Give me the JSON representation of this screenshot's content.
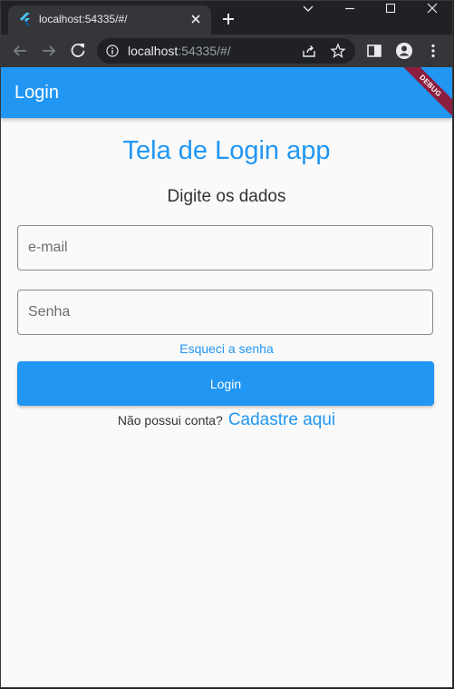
{
  "browser": {
    "tab_title": "localhost:54335/#/",
    "url_host": "localhost",
    "url_rest": ":54335/#/"
  },
  "app": {
    "appbar_title": "Login",
    "debug_banner": "DEBUG",
    "page_title": "Tela de Login app",
    "subtitle": "Digite os dados",
    "email_placeholder": "e-mail",
    "password_placeholder": "Senha",
    "forgot_password": "Esqueci a senha",
    "login_button": "Login",
    "signup_question": "Não possui conta?",
    "signup_link": "Cadastre aqui"
  },
  "colors": {
    "primary": "#2196f3",
    "debug_banner": "#8b1e3f",
    "background": "#fafafa"
  }
}
